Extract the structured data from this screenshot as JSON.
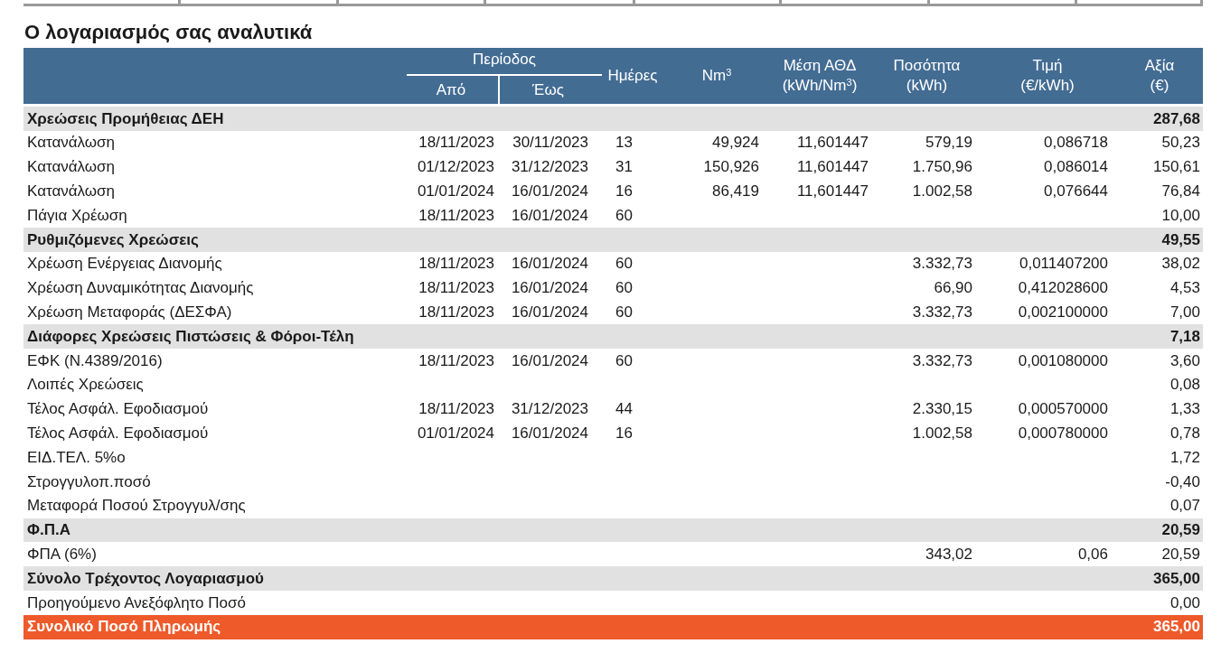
{
  "title": "Ο λογαριασμός σας αναλυτικά",
  "table": {
    "period_header": "Περίοδος",
    "columns": [
      {
        "lines": [
          "Από"
        ]
      },
      {
        "lines": [
          "Έως"
        ]
      },
      {
        "lines": [
          "Ημέρες"
        ]
      },
      {
        "lines": [
          "Nm$^{3}$"
        ]
      },
      {
        "lines": [
          "Μέση ΑΘΔ",
          "(kWh/Nm$^{3}$)"
        ]
      },
      {
        "lines": [
          "Ποσότητα",
          "(kWh)"
        ]
      },
      {
        "lines": [
          "Τιμή",
          "(€/kWh)"
        ]
      },
      {
        "lines": [
          "Αξία",
          "(€)"
        ]
      }
    ],
    "rows": [
      {
        "kind": "section",
        "label": "Χρεώσεις Προμήθειας ΔΕΗ",
        "value": "287,68"
      },
      {
        "kind": "item",
        "label": "Κατανάλωση",
        "from": "18/11/2023",
        "to": "30/11/2023",
        "days": "13",
        "nm3": "49,924",
        "avg": "11,601447",
        "qty": "579,19",
        "price": "0,086718",
        "value": "50,23"
      },
      {
        "kind": "item",
        "label": "Κατανάλωση",
        "from": "01/12/2023",
        "to": "31/12/2023",
        "days": "31",
        "nm3": "150,926",
        "avg": "11,601447",
        "qty": "1.750,96",
        "price": "0,086014",
        "value": "150,61"
      },
      {
        "kind": "item",
        "label": "Κατανάλωση",
        "from": "01/01/2024",
        "to": "16/01/2024",
        "days": "16",
        "nm3": "86,419",
        "avg": "11,601447",
        "qty": "1.002,58",
        "price": "0,076644",
        "value": "76,84"
      },
      {
        "kind": "item",
        "label": "Πάγια Χρέωση",
        "from": "18/11/2023",
        "to": "16/01/2024",
        "days": "60",
        "value": "10,00"
      },
      {
        "kind": "section",
        "label": "Ρυθμιζόμενες Χρεώσεις",
        "value": "49,55"
      },
      {
        "kind": "item",
        "label": "Χρέωση Ενέργειας Διανομής",
        "from": "18/11/2023",
        "to": "16/01/2024",
        "days": "60",
        "qty": "3.332,73",
        "price": "0,011407200",
        "value": "38,02"
      },
      {
        "kind": "item",
        "label": "Χρέωση Δυναμικότητας Διανομής",
        "from": "18/11/2023",
        "to": "16/01/2024",
        "days": "60",
        "qty": "66,90",
        "price": "0,412028600",
        "value": "4,53"
      },
      {
        "kind": "item",
        "label": "Χρέωση Μεταφοράς (ΔΕΣΦΑ)",
        "from": "18/11/2023",
        "to": "16/01/2024",
        "days": "60",
        "qty": "3.332,73",
        "price": "0,002100000",
        "value": "7,00"
      },
      {
        "kind": "section",
        "label": "Διάφορες Χρεώσεις Πιστώσεις & Φόροι-Τέλη",
        "value": "7,18"
      },
      {
        "kind": "item",
        "label": "ΕΦΚ (N.4389/2016)",
        "from": "18/11/2023",
        "to": "16/01/2024",
        "days": "60",
        "qty": "3.332,73",
        "price": "0,001080000",
        "value": "3,60"
      },
      {
        "kind": "item",
        "label": "Λοιπές Χρεώσεις",
        "value": "0,08"
      },
      {
        "kind": "item",
        "label": "Τέλος Ασφάλ. Εφοδιασμού",
        "from": "18/11/2023",
        "to": "31/12/2023",
        "days": "44",
        "qty": "2.330,15",
        "price": "0,000570000",
        "value": "1,33"
      },
      {
        "kind": "item",
        "label": "Τέλος Ασφάλ. Εφοδιασμού",
        "from": "01/01/2024",
        "to": "16/01/2024",
        "days": "16",
        "qty": "1.002,58",
        "price": "0,000780000",
        "value": "0,78"
      },
      {
        "kind": "item",
        "label": "ΕΙΔ.ΤΕΛ. 5%ο",
        "value": "1,72"
      },
      {
        "kind": "item",
        "label": "Στρογγυλοπ.ποσό",
        "value": "-0,40"
      },
      {
        "kind": "item",
        "label": "Μεταφορά Ποσού Στρογγυλ/σης",
        "value": "0,07"
      },
      {
        "kind": "section",
        "label": "Φ.Π.Α",
        "value": "20,59"
      },
      {
        "kind": "item",
        "label": "ΦΠΑ (6%)",
        "qty": "343,02",
        "price": "0,06",
        "value": "20,59"
      },
      {
        "kind": "section",
        "label": "Σύνολο Τρέχοντος Λογαριασμού",
        "value": "365,00"
      },
      {
        "kind": "item",
        "label": "Προηγούμενο Ανεξόφλητο Ποσό",
        "value": "0,00"
      },
      {
        "kind": "grand_total",
        "label": "Συνολικό Ποσό Πληρωμής",
        "value": "365,00"
      }
    ]
  }
}
